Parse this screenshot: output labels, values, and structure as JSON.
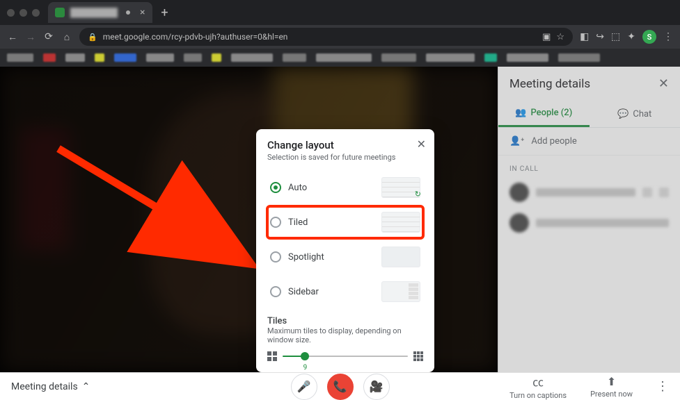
{
  "browser": {
    "url": "meet.google.com/rcy-pdvb-ujh?authuser=0&hl=en",
    "avatar_initial": "S"
  },
  "sidepanel": {
    "title": "Meeting details",
    "tabs": {
      "people": "People (2)",
      "chat": "Chat"
    },
    "add_people": "Add people",
    "section": "IN CALL"
  },
  "bottombar": {
    "meeting_details": "Meeting details",
    "captions": "Turn on captions",
    "present": "Present now"
  },
  "modal": {
    "title": "Change layout",
    "subtitle": "Selection is saved for future meetings",
    "options": {
      "auto": "Auto",
      "tiled": "Tiled",
      "spotlight": "Spotlight",
      "sidebar": "Sidebar"
    },
    "tiles_heading": "Tiles",
    "tiles_sub": "Maximum tiles to display, depending on window size.",
    "slider_value": "9"
  }
}
